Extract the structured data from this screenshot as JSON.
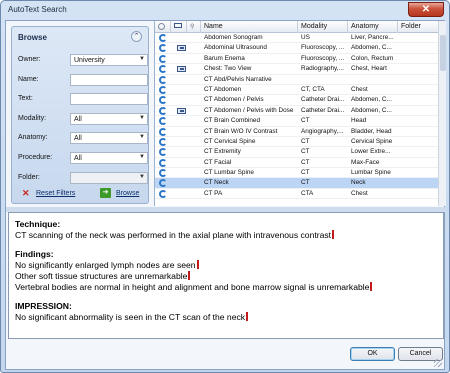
{
  "window": {
    "title": "AutoText Search",
    "close_glyph": "✕"
  },
  "browse": {
    "header": "Browse",
    "collapse_glyph": "⌃",
    "fields": [
      {
        "label": "Owner:",
        "value": "University",
        "type": "select"
      },
      {
        "label": "Name:",
        "value": "",
        "type": "text"
      },
      {
        "label": "Text:",
        "value": "",
        "type": "text"
      },
      {
        "label": "Modality:",
        "value": "All",
        "type": "select"
      },
      {
        "label": "Anatomy:",
        "value": "All",
        "type": "select"
      },
      {
        "label": "Procedure:",
        "value": "All",
        "type": "select"
      },
      {
        "label": "Folder:",
        "value": "",
        "type": "select-disabled"
      }
    ],
    "reset_label": "Reset Filters",
    "browse_label": "Browse"
  },
  "grid": {
    "columns": [
      "",
      "",
      "Name",
      "Modality",
      "Anatomy",
      "Folder"
    ],
    "rows": [
      {
        "linked": false,
        "name": "Abdomen Sonogram",
        "modality": "US",
        "anatomy": "Liver, Pancre..."
      },
      {
        "linked": true,
        "name": "Abdominal Ultrasound",
        "modality": "Fluoroscopy, ...",
        "anatomy": "Abdomen, C..."
      },
      {
        "linked": false,
        "name": "Barum Enema",
        "modality": "Fluoroscopy, ...",
        "anatomy": "Colon, Rectum"
      },
      {
        "linked": true,
        "name": "Chest: Two View",
        "modality": "Radiography,...",
        "anatomy": "Chest, Heart"
      },
      {
        "linked": false,
        "name": "CT Abd/Pelvis Narrative",
        "modality": "",
        "anatomy": ""
      },
      {
        "linked": false,
        "name": "CT Abdomen",
        "modality": "CT, CTA",
        "anatomy": "Chest"
      },
      {
        "linked": false,
        "name": "CT Abdomen / Pelvis",
        "modality": "Catheter Drai...",
        "anatomy": "Abdomen, C..."
      },
      {
        "linked": true,
        "name": "CT Abdomen / Pelvis with Dose",
        "modality": "Catheter Drai...",
        "anatomy": "Abdomen, C..."
      },
      {
        "linked": false,
        "name": "CT Brain Combined",
        "modality": "CT",
        "anatomy": "Head"
      },
      {
        "linked": false,
        "name": "CT Brain W/O IV Contrast",
        "modality": "Angiography,...",
        "anatomy": "Bladder, Head"
      },
      {
        "linked": false,
        "name": "CT Cervical Spine",
        "modality": "CT",
        "anatomy": "Cervical Spine"
      },
      {
        "linked": false,
        "name": "CT Extremity",
        "modality": "CT",
        "anatomy": "Lower Extre..."
      },
      {
        "linked": false,
        "name": "CT Facial",
        "modality": "CT",
        "anatomy": "Max-Face"
      },
      {
        "linked": false,
        "name": "CT Lumbar Spine",
        "modality": "CT",
        "anatomy": "Lumbar Spine"
      },
      {
        "linked": false,
        "name": "CT Neck",
        "modality": "CT",
        "anatomy": "Neck",
        "selected": true
      },
      {
        "linked": false,
        "name": "CT PA",
        "modality": "CTA",
        "anatomy": "Chest"
      }
    ]
  },
  "preview": {
    "lines": [
      {
        "text": "Technique:",
        "bold": true
      },
      {
        "text": "CT scanning of the neck was performed in the axial plane with intravenous contrast",
        "caret": true
      },
      {
        "text": "",
        "bold": false
      },
      {
        "text": "Findings:",
        "bold": true
      },
      {
        "text": "No significantly enlarged lymph nodes are seen",
        "caret": true
      },
      {
        "text": "Other soft tissue structures are unremarkable",
        "caret": true
      },
      {
        "text": "Vertebral bodies are normal in height and alignment and bone marrow signal is unremarkable",
        "caret": true
      },
      {
        "text": "",
        "bold": false
      },
      {
        "text": "IMPRESSION:",
        "bold": true
      },
      {
        "text": "No significant abnormality is seen in the CT scan of the neck",
        "caret": true
      }
    ]
  },
  "buttons": {
    "ok": "OK",
    "cancel": "Cancel"
  }
}
